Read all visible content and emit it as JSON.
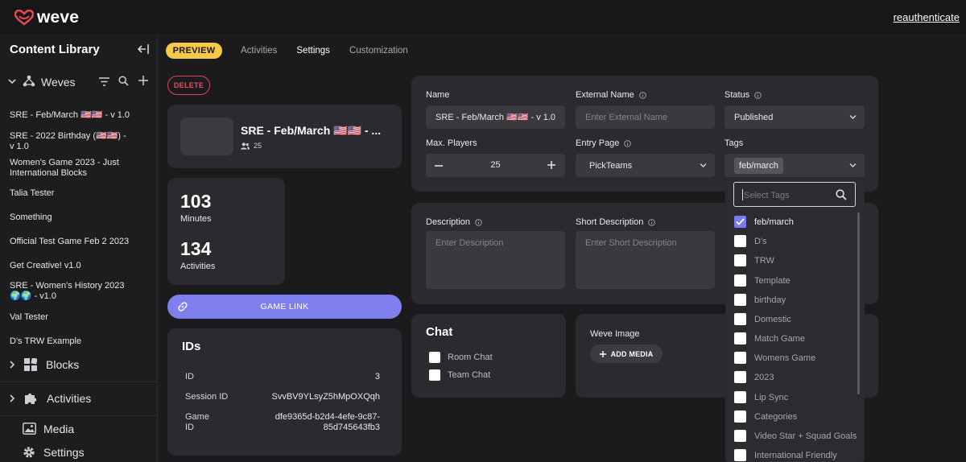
{
  "app": {
    "brand": "weve",
    "reauth_label": "reauthenticate",
    "accent": "#7f7ff0",
    "preview_color": "#f7c948",
    "danger_color": "#e0465a"
  },
  "sidebar": {
    "title": "Content Library",
    "weves_label": "Weves",
    "items": [
      "SRE - Feb/March 🇺🇸🇺🇸 - v 1.0",
      "SRE - 2022 Birthday (🇺🇸🇺🇸) - v 1.0",
      "Women's Game 2023 - Just International Blocks",
      "Talia Tester",
      "Something",
      "Official Test Game Feb 2 2023",
      "Get Creative! v1.0",
      "SRE - Women's History 2023 🌍🌍 - v1.0",
      "Val Tester",
      "D's TRW Example"
    ],
    "sections": [
      "Blocks",
      "Activities",
      "Media",
      "Settings"
    ]
  },
  "tabs": {
    "preview": "PREVIEW",
    "items": [
      "Activities",
      "Settings",
      "Customization"
    ],
    "active": "Settings"
  },
  "delete_label": "DELETE",
  "game": {
    "name": "SRE - Feb/March 🇺🇸🇺🇸 - ...",
    "players": "25"
  },
  "stats": {
    "minutes_value": "103",
    "minutes_label": "Minutes",
    "activities_value": "134",
    "activities_label": "Activities"
  },
  "game_link_label": "GAME LINK",
  "ids": {
    "title": "IDs",
    "rows": [
      {
        "label": "ID",
        "value": "3"
      },
      {
        "label": "Session ID",
        "value": "SvvBV9YLsyZ5hMpOXQqh"
      },
      {
        "label": "Game ID",
        "value": "dfe9365d-b2d4-4efe-9c87-85d745643fb3"
      }
    ]
  },
  "form": {
    "name_label": "Name",
    "name_value": "SRE - Feb/March 🇺🇸🇺🇸 - v 1.0",
    "external_name_label": "External Name",
    "external_name_placeholder": "Enter External Name",
    "status_label": "Status",
    "status_value": "Published",
    "max_players_label": "Max. Players",
    "max_players_value": "25",
    "entry_page_label": "Entry Page",
    "entry_page_value": "PickTeams",
    "tags_label": "Tags",
    "tags_selected": "feb/march",
    "description_label": "Description",
    "description_placeholder": "Enter Description",
    "short_description_label": "Short Description",
    "short_description_placeholder": "Enter Short Description"
  },
  "chat": {
    "title": "Chat",
    "options": [
      "Room Chat",
      "Team Chat"
    ]
  },
  "weve_image": {
    "title": "Weve Image",
    "add_media_label": "ADD MEDIA"
  },
  "tag_dropdown": {
    "search_placeholder": "Select Tags",
    "options": [
      {
        "label": "feb/march",
        "checked": true
      },
      {
        "label": "D's",
        "checked": false
      },
      {
        "label": "TRW",
        "checked": false
      },
      {
        "label": "Template",
        "checked": false
      },
      {
        "label": "birthday",
        "checked": false
      },
      {
        "label": "Domestic",
        "checked": false
      },
      {
        "label": "Match Game",
        "checked": false
      },
      {
        "label": "Womens Game",
        "checked": false
      },
      {
        "label": "2023",
        "checked": false
      },
      {
        "label": "Lip Sync",
        "checked": false
      },
      {
        "label": "Categories",
        "checked": false
      },
      {
        "label": "Video Star + Squad Goals",
        "checked": false
      },
      {
        "label": "International Friendly",
        "checked": false
      }
    ]
  }
}
